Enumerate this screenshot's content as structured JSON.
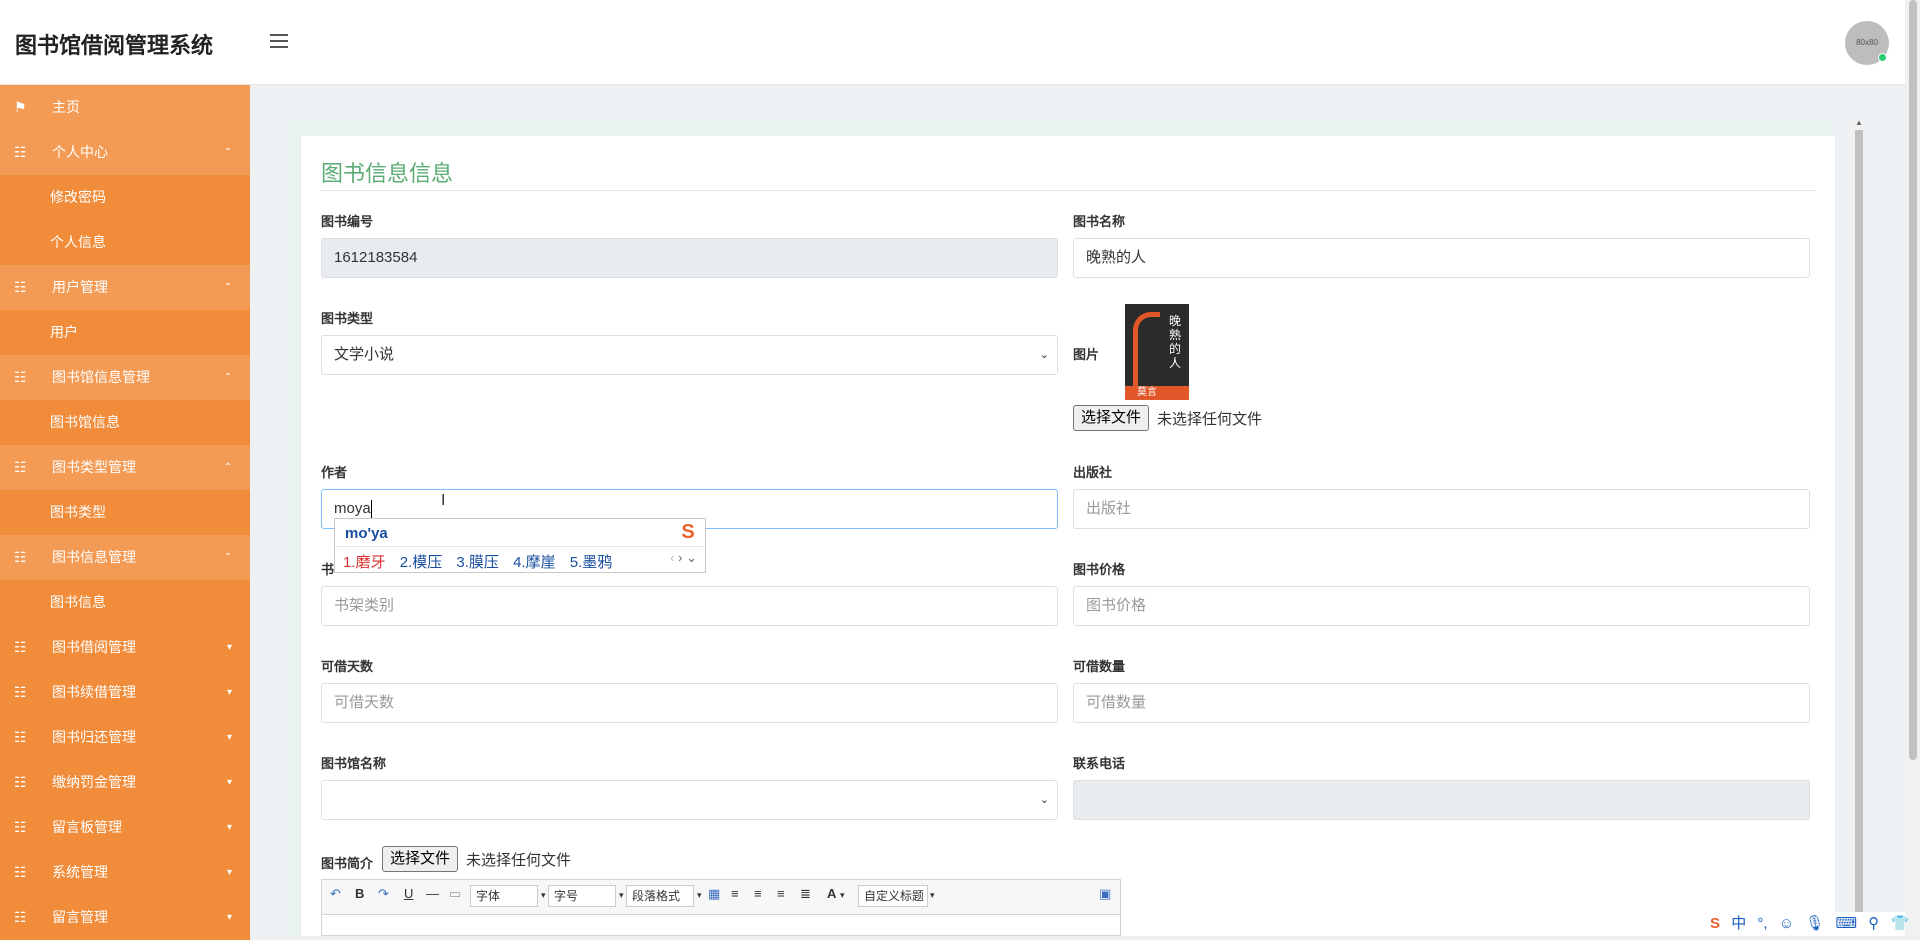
{
  "header": {
    "title": "图书馆借阅管理系统",
    "avatar_text": "80x80"
  },
  "sidebar": {
    "items": [
      {
        "label": "主页",
        "icon": "flag-icon",
        "type": "top"
      },
      {
        "label": "个人中心",
        "icon": "grid-icon",
        "type": "top",
        "caret": "⌃"
      },
      {
        "label": "修改密码",
        "type": "sub"
      },
      {
        "label": "个人信息",
        "type": "sub"
      },
      {
        "label": "用户管理",
        "icon": "grid-icon",
        "type": "top",
        "caret": "⌃"
      },
      {
        "label": "用户",
        "type": "sub"
      },
      {
        "label": "图书馆信息管理",
        "icon": "grid-icon",
        "type": "top",
        "caret": "⌃"
      },
      {
        "label": "图书馆信息",
        "type": "sub"
      },
      {
        "label": "图书类型管理",
        "icon": "grid-icon",
        "type": "top",
        "caret": "⌃"
      },
      {
        "label": "图书类型",
        "type": "sub"
      },
      {
        "label": "图书信息管理",
        "icon": "grid-icon",
        "type": "top",
        "caret": "⌃"
      },
      {
        "label": "图书信息",
        "type": "sub"
      },
      {
        "label": "图书借阅管理",
        "icon": "grid-icon",
        "type": "plain",
        "caret": "▾"
      },
      {
        "label": "图书续借管理",
        "icon": "grid-icon",
        "type": "plain",
        "caret": "▾"
      },
      {
        "label": "图书归还管理",
        "icon": "grid-icon",
        "type": "plain",
        "caret": "▾"
      },
      {
        "label": "缴纳罚金管理",
        "icon": "grid-icon",
        "type": "plain",
        "caret": "▾"
      },
      {
        "label": "留言板管理",
        "icon": "grid-icon",
        "type": "plain",
        "caret": "▾"
      },
      {
        "label": "系统管理",
        "icon": "grid-icon",
        "type": "plain",
        "caret": "▾"
      },
      {
        "label": "留言管理",
        "icon": "grid-icon",
        "type": "plain",
        "caret": "▾"
      }
    ]
  },
  "form": {
    "title": "图书信息信息",
    "book_no_label": "图书编号",
    "book_no_value": "1612183584",
    "book_name_label": "图书名称",
    "book_name_value": "晚熟的人",
    "book_type_label": "图书类型",
    "book_type_value": "文学小说",
    "image_label": "图片",
    "file_button": "选择文件",
    "file_none": "未选择任何文件",
    "author_label": "作者",
    "author_value": "moya",
    "publisher_label": "出版社",
    "publisher_placeholder": "出版社",
    "shelf_label": "书",
    "shelf_placeholder": "书架类别",
    "price_label": "图书价格",
    "price_placeholder": "图书价格",
    "days_label": "可借天数",
    "days_placeholder": "可借天数",
    "qty_label": "可借数量",
    "qty_placeholder": "可借数量",
    "library_label": "图书馆名称",
    "library_value": "",
    "phone_label": "联系电话",
    "phone_value": "",
    "intro_label": "图书简介",
    "cover_title": "晚熟的人",
    "cover_author": "莫言"
  },
  "ime": {
    "pinyin": "mo'ya",
    "candidates": [
      "1.磨牙",
      "2.模压",
      "3.膜压",
      "4.摩崖",
      "5.墨鸦"
    ],
    "logo": "S"
  },
  "editor": {
    "font_label": "字体",
    "size_label": "字号",
    "paragraph_label": "段落格式",
    "custom_title_label": "自定义标题"
  },
  "tray": {
    "ime_mode": "中",
    "punct": "°,"
  }
}
